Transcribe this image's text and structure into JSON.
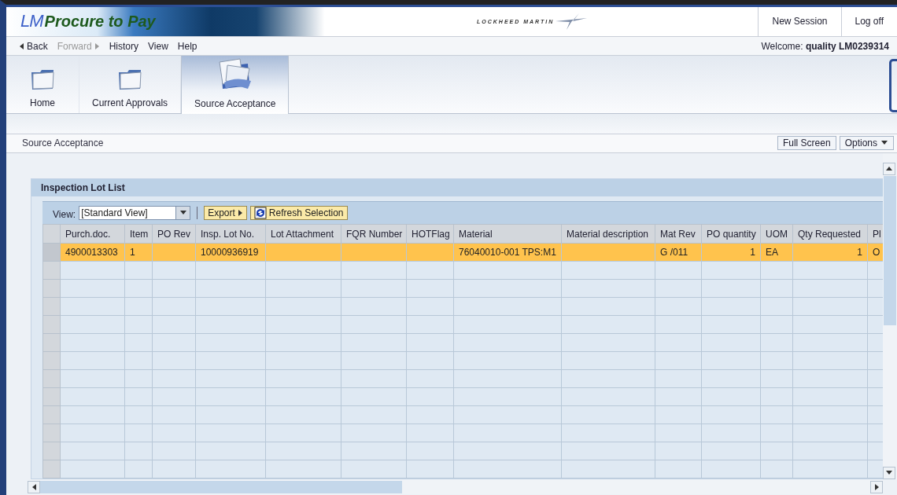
{
  "header": {
    "logo_lm": "LM",
    "logo_text": "Procure to Pay",
    "company": "LOCKHEED MARTIN",
    "links": [
      "New Session",
      "Log off"
    ]
  },
  "nav": {
    "items": [
      {
        "label": "Back",
        "kind": "back",
        "disabled": false
      },
      {
        "label": "Forward",
        "kind": "forward",
        "disabled": true
      },
      {
        "label": "History",
        "kind": "menu",
        "disabled": false
      },
      {
        "label": "View",
        "kind": "menu",
        "disabled": false
      },
      {
        "label": "Help",
        "kind": "menu",
        "disabled": false
      }
    ],
    "welcome": "Welcome: **quality LM0239314**"
  },
  "tabs": [
    {
      "label": "Home",
      "kind": "folder",
      "selected": false
    },
    {
      "label": "Current Approvals",
      "kind": "folder",
      "selected": false
    },
    {
      "label": "Source Acceptance",
      "kind": "papers",
      "selected": true
    }
  ],
  "page": {
    "title": "Source Acceptance",
    "buttons": [
      "Full Screen",
      "Options"
    ]
  },
  "panel": {
    "title": "Inspection Lot List",
    "view_label": "View:",
    "view_value": "[Standard View]",
    "export": "Export",
    "refresh": "Refresh Selection"
  },
  "table": {
    "columns": [
      "Purch.doc.",
      "Item",
      "PO Rev",
      "Insp. Lot No.",
      "Lot Attachment",
      "FQR Number",
      "HOTFlag",
      "Material",
      "Material description",
      "Mat Rev",
      "PO quantity",
      "UOM",
      "Qty Requested",
      "Pl"
    ],
    "rows": [
      {
        "selected": true,
        "cells": [
          "4900013303",
          "1",
          "",
          "10000936919",
          "",
          "",
          "",
          "76040010-001 TPS:M1",
          "",
          "G /011",
          "1",
          "EA",
          "1",
          "O"
        ]
      }
    ]
  }
}
